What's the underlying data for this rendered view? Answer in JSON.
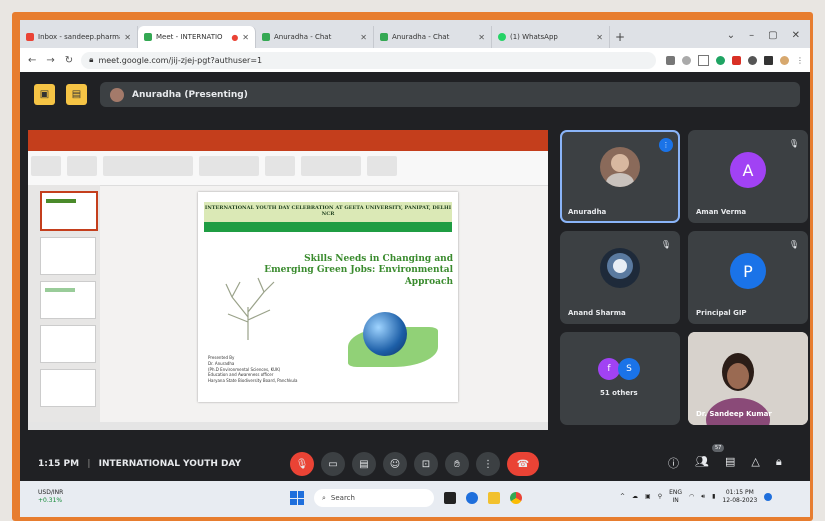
{
  "browser": {
    "tabs": [
      {
        "label": "Inbox - sandeep.pharma",
        "color": "#ea4335",
        "active": false
      },
      {
        "label": "Meet - INTERNATIO",
        "color": "#34a853",
        "active": true
      },
      {
        "label": "Anuradha - Chat",
        "color": "#34a853",
        "active": false
      },
      {
        "label": "Anuradha - Chat",
        "color": "#34a853",
        "active": false
      },
      {
        "label": "(1) WhatsApp",
        "color": "#25d366",
        "active": false
      }
    ],
    "url": "meet.google.com/jij-zjej-pgt?authuser=1"
  },
  "meet": {
    "presenting": "Anuradha (Presenting)",
    "slide": {
      "header": "INTERNATIONAL YOUTH DAY CELEBRATION AT GEETA UNIVERSITY, PANIPAT, DELHI NCR",
      "title": "Skills Needs in Changing and Emerging Green Jobs: Environmental Approach",
      "credits": [
        "Presented By",
        "Dr. Anuradha",
        "(Ph.D Environmental Sciences, KUK)",
        "Education and Awareness officer",
        "Haryana State Biodiversity Board, Panchkula"
      ]
    },
    "participants": [
      {
        "name": "Anuradha",
        "type": "photo"
      },
      {
        "name": "Aman Verma",
        "initial": "A",
        "color": "#a142f4"
      },
      {
        "name": "Anand Sharma",
        "type": "photo"
      },
      {
        "name": "Principal GIP",
        "initial": "P",
        "color": "#1a73e8"
      },
      {
        "name": "51 others",
        "initials": [
          "f",
          "S"
        ]
      },
      {
        "name": "Dr. Sandeep Kumar",
        "type": "photo"
      }
    ],
    "time": "1:15 PM",
    "meeting_title": "INTERNATIONAL YOUTH DAY",
    "people_count": "57"
  },
  "taskbar": {
    "ticker": "USD/INR",
    "ticker_change": "+0.31%",
    "search_placeholder": "Search",
    "lang": "ENG",
    "region": "IN",
    "clock_time": "01:15 PM",
    "clock_date": "12-08-2023"
  }
}
